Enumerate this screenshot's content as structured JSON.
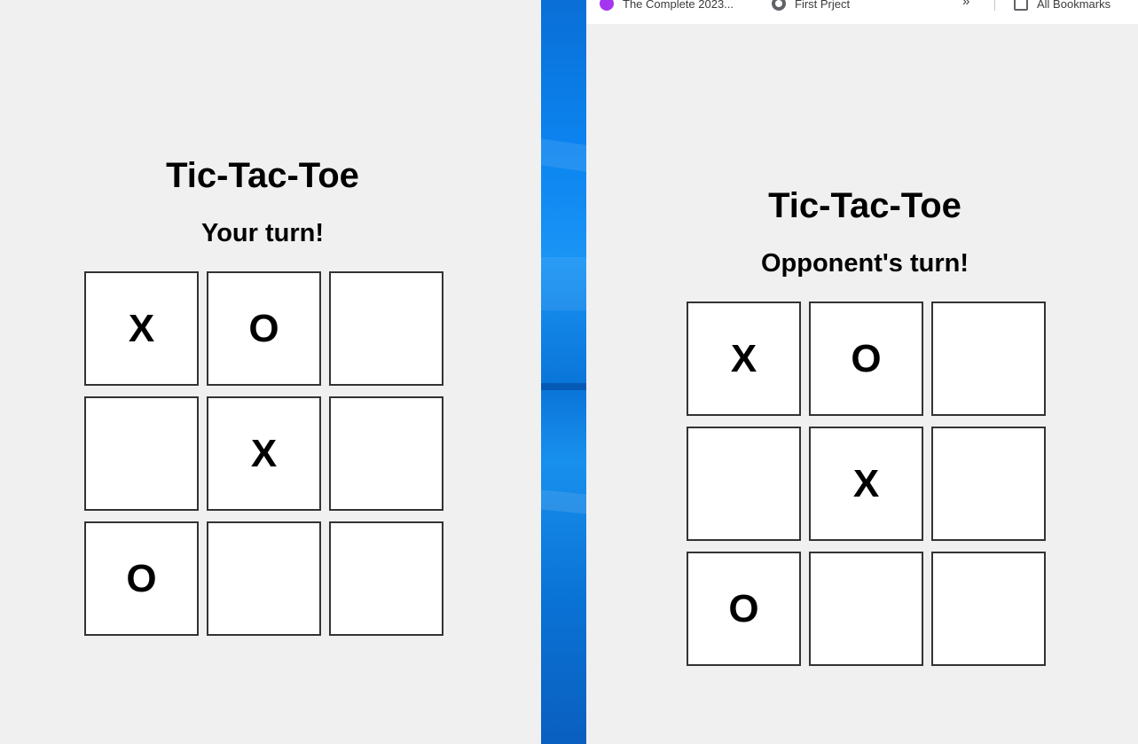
{
  "bookmarks_bar": {
    "items": [
      {
        "label": "The Complete 2023...",
        "icon": "udemy-icon"
      },
      {
        "label": "First Prject",
        "icon": "globe-icon"
      }
    ],
    "more_label": "»",
    "all_bookmarks_label": "All Bookmarks"
  },
  "left_window": {
    "title": "Tic-Tac-Toe",
    "status": "Your turn!",
    "board": [
      "X",
      "O",
      "",
      "",
      "X",
      "",
      "O",
      "",
      ""
    ]
  },
  "right_window": {
    "title": "Tic-Tac-Toe",
    "status": "Opponent's turn!",
    "board": [
      "X",
      "O",
      "",
      "",
      "X",
      "",
      "O",
      "",
      ""
    ]
  }
}
